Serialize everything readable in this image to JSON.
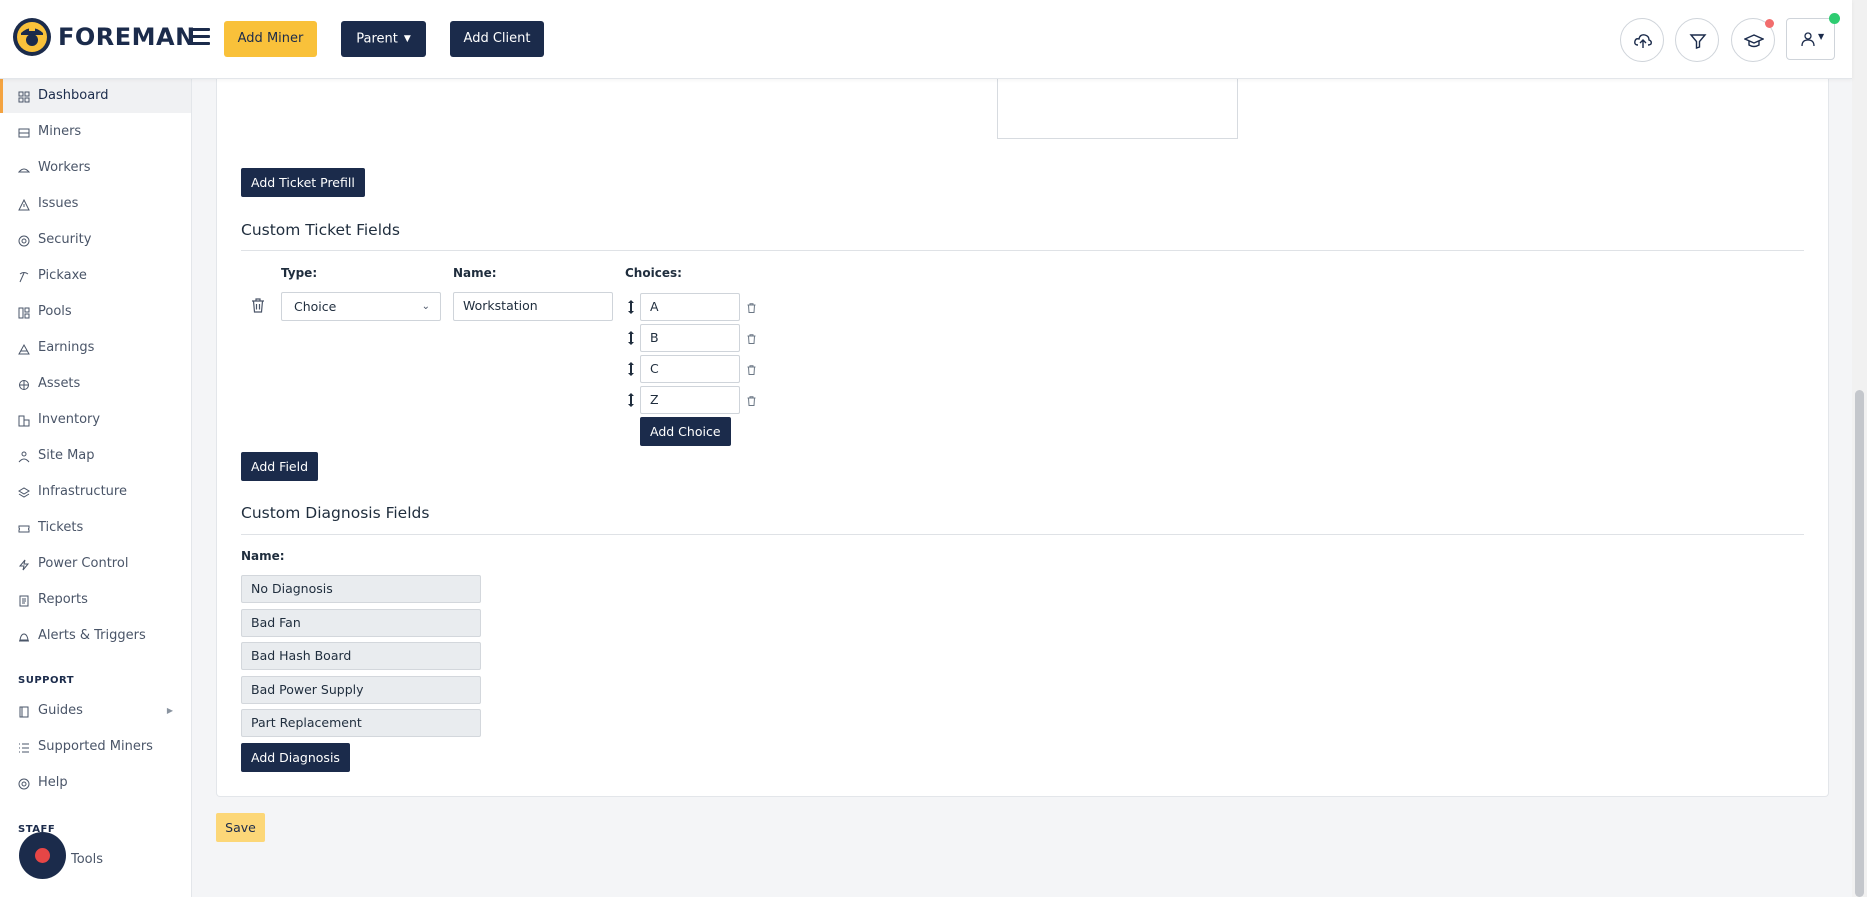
{
  "header": {
    "brand": "FOREMAN",
    "add_miner": "Add Miner",
    "parent": "Parent",
    "add_client": "Add Client",
    "icons": [
      "cloud-upload-icon",
      "filter-icon",
      "graduation-cap-icon",
      "user-icon"
    ]
  },
  "sidebar": {
    "items": [
      {
        "label": "Dashboard",
        "icon": "dashboard-icon"
      },
      {
        "label": "Miners",
        "icon": "miners-icon"
      },
      {
        "label": "Workers",
        "icon": "workers-icon"
      },
      {
        "label": "Issues",
        "icon": "warning-icon"
      },
      {
        "label": "Security",
        "icon": "shield-icon"
      },
      {
        "label": "Pickaxe",
        "icon": "pickaxe-icon"
      },
      {
        "label": "Pools",
        "icon": "pools-icon"
      },
      {
        "label": "Earnings",
        "icon": "earnings-icon"
      },
      {
        "label": "Assets",
        "icon": "assets-icon"
      },
      {
        "label": "Inventory",
        "icon": "inventory-icon"
      },
      {
        "label": "Site Map",
        "icon": "site-map-icon"
      },
      {
        "label": "Infrastructure",
        "icon": "layers-icon"
      },
      {
        "label": "Tickets",
        "icon": "ticket-icon"
      },
      {
        "label": "Power Control",
        "icon": "bolt-icon"
      },
      {
        "label": "Reports",
        "icon": "reports-icon"
      },
      {
        "label": "Alerts & Triggers",
        "icon": "bell-icon"
      }
    ],
    "support_label": "SUPPORT",
    "support_items": [
      {
        "label": "Guides",
        "icon": "book-icon"
      },
      {
        "label": "Supported Miners",
        "icon": "list-icon"
      },
      {
        "label": "Help",
        "icon": "help-icon"
      }
    ],
    "staff_label": "STAFF",
    "staff_items": [
      {
        "label": "Tools",
        "icon": "tools-icon"
      }
    ]
  },
  "main": {
    "add_ticket_prefill": "Add Ticket Prefill",
    "custom_ticket_fields": {
      "title": "Custom Ticket Fields",
      "type_label": "Type:",
      "name_label": "Name:",
      "choices_label": "Choices:",
      "type_value": "Choice",
      "name_value": "Workstation",
      "choices": [
        "A",
        "B",
        "C",
        "Z"
      ],
      "add_choice": "Add Choice",
      "add_field": "Add Field"
    },
    "custom_diagnosis_fields": {
      "title": "Custom Diagnosis Fields",
      "name_label": "Name:",
      "items": [
        "No Diagnosis",
        "Bad Fan",
        "Bad Hash Board",
        "Bad Power Supply",
        "Part Replacement"
      ],
      "add_diagnosis": "Add Diagnosis"
    },
    "save": "Save"
  },
  "colors": {
    "brand_navy": "#1b2b4b",
    "accent_yellow": "#f9c13a",
    "active_indicator": "#f4a340",
    "notification": "#f26d6d",
    "online": "#2ecc71",
    "record": "#e64646"
  }
}
